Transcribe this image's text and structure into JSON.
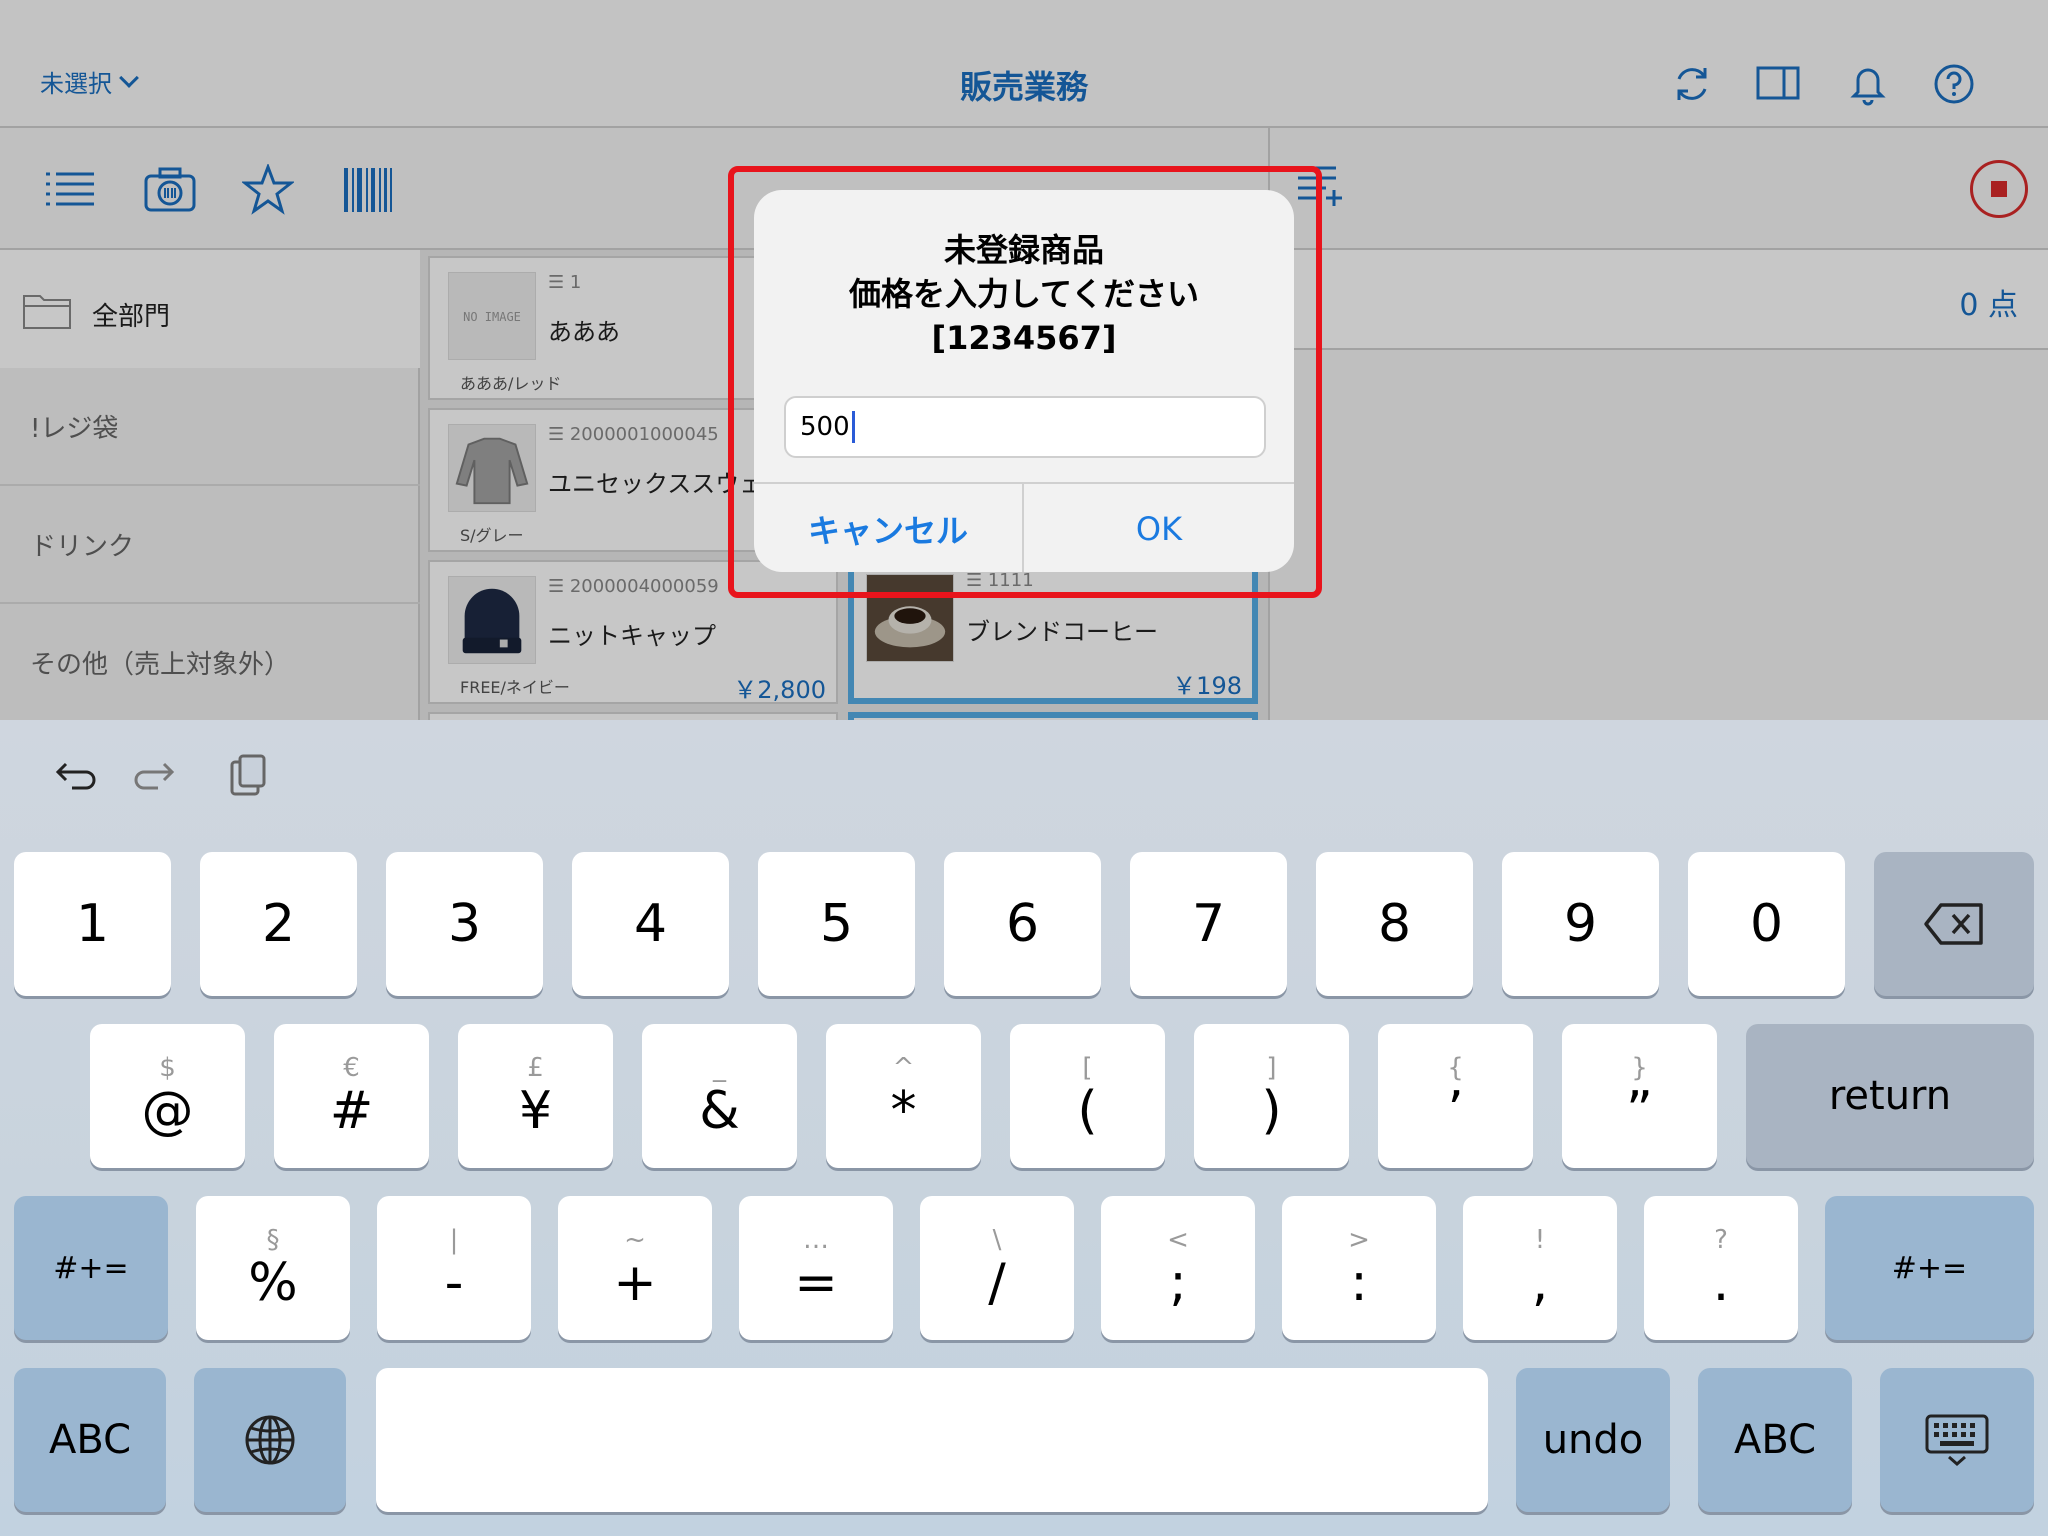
{
  "header": {
    "store_select": "未選択",
    "title": "販売業務"
  },
  "departments": {
    "all": "全部門",
    "items": [
      "!レジ袋",
      "ドリンク",
      "その他（売上対象外）"
    ]
  },
  "products": [
    {
      "code": "1",
      "name": "あああ",
      "variant": "あああ/レッド",
      "price": "",
      "thumb": "NO IMAGE"
    },
    {
      "code": "2000001000045",
      "name": "ユニセックススウェ",
      "variant": "S/グレー",
      "price": "",
      "thumb": ""
    },
    {
      "code": "2000004000059",
      "name": "ニットキャップ",
      "variant": "FREE/ネイビー",
      "price": "￥2,800",
      "thumb": ""
    },
    {
      "code": "1111",
      "name": "ブレンドコーヒー",
      "variant": "",
      "price": "￥198",
      "thumb": ""
    }
  ],
  "cart": {
    "count": "0 点"
  },
  "alert": {
    "title_line1": "未登録商品",
    "title_line2": "価格を入力してください",
    "title_line3": "[1234567]",
    "input_value": "500",
    "cancel_label": "キャンセル",
    "ok_label": "OK"
  },
  "keyboard": {
    "row1": [
      "1",
      "2",
      "3",
      "4",
      "5",
      "6",
      "7",
      "8",
      "9",
      "0"
    ],
    "row2": [
      {
        "alt": "$",
        "main": "@"
      },
      {
        "alt": "€",
        "main": "#"
      },
      {
        "alt": "£",
        "main": "¥"
      },
      {
        "alt": "_",
        "main": "&"
      },
      {
        "alt": "^",
        "main": "*"
      },
      {
        "alt": "[",
        "main": "("
      },
      {
        "alt": "]",
        "main": ")"
      },
      {
        "alt": "{",
        "main": "’"
      },
      {
        "alt": "}",
        "main": "”"
      }
    ],
    "row3": [
      {
        "alt": "§",
        "main": "%"
      },
      {
        "alt": "|",
        "main": "-"
      },
      {
        "alt": "~",
        "main": "+"
      },
      {
        "alt": "…",
        "main": "="
      },
      {
        "alt": "\\",
        "main": "/"
      },
      {
        "alt": "<",
        "main": ";"
      },
      {
        "alt": ">",
        "main": ":"
      },
      {
        "alt": "!",
        "main": ","
      },
      {
        "alt": "?",
        "main": "."
      }
    ],
    "return_label": "return",
    "symbols_label": "#+=",
    "abc_label": "ABC",
    "undo_label": "undo"
  },
  "colors": {
    "accent": "#1a6fc0",
    "highlight": "#e8141c",
    "stop": "#d92b2b"
  }
}
